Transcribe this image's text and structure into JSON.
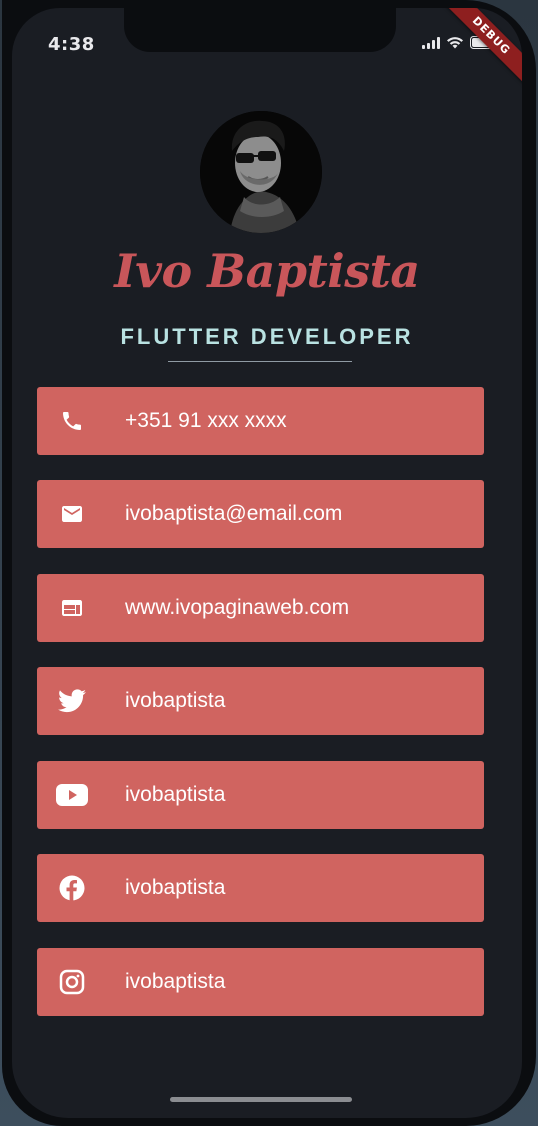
{
  "status_bar": {
    "time": "4:38",
    "debug_label": "DEBUG"
  },
  "profile": {
    "name": "Ivo Baptista",
    "role": "FLUTTER DEVELOPER"
  },
  "contacts": [
    {
      "icon": "phone-icon",
      "label": "+351 91 xxx xxxx"
    },
    {
      "icon": "email-icon",
      "label": "ivobaptista@email.com"
    },
    {
      "icon": "web-icon",
      "label": "www.ivopaginaweb.com"
    },
    {
      "icon": "twitter-icon",
      "label": "ivobaptista"
    },
    {
      "icon": "youtube-icon",
      "label": "ivobaptista"
    },
    {
      "icon": "facebook-icon",
      "label": "ivobaptista"
    },
    {
      "icon": "instagram-icon",
      "label": "ivobaptista"
    }
  ],
  "colors": {
    "background": "#1a1d23",
    "card": "#d06460",
    "name": "#c9565a",
    "role": "#b9e2e2",
    "debug_banner": "#8e1f1f"
  }
}
